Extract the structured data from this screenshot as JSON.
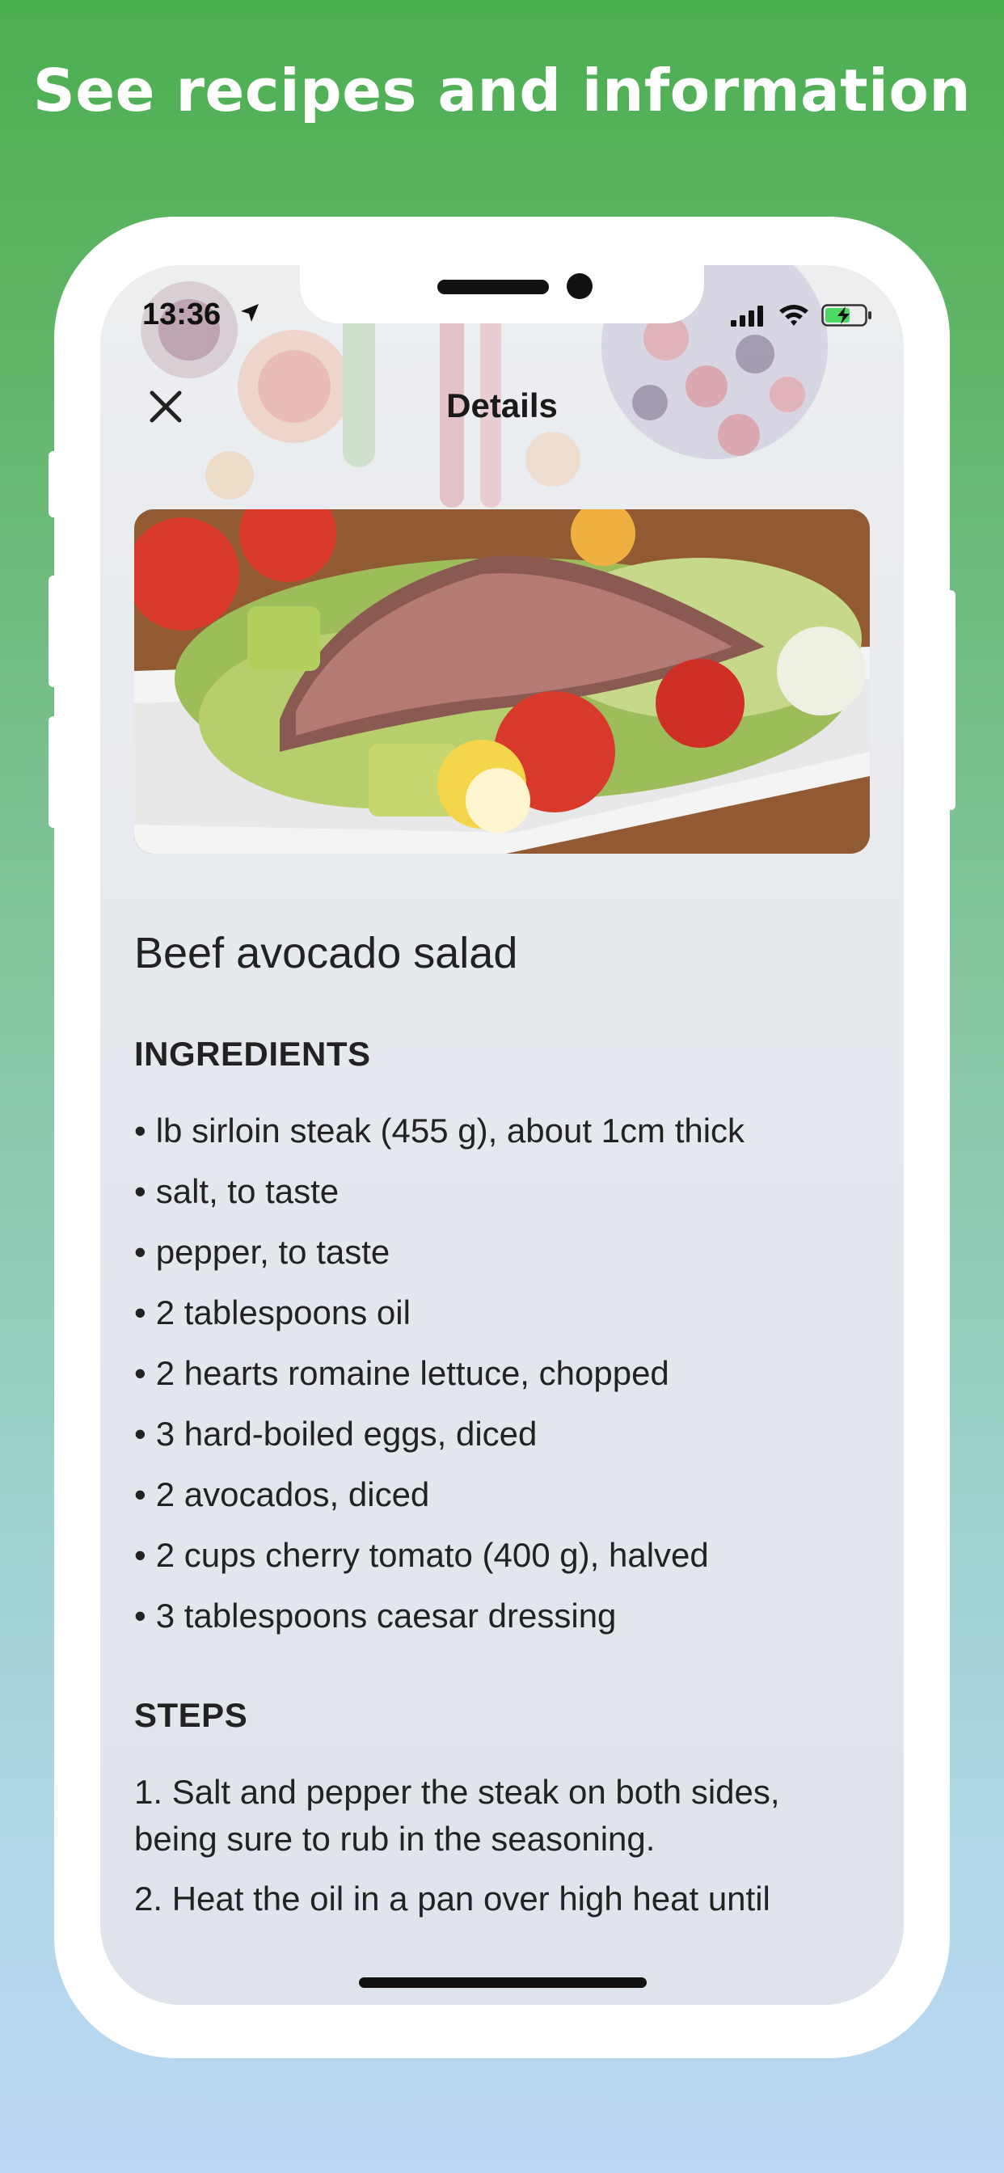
{
  "promo": {
    "headline": "See recipes and information"
  },
  "status_bar": {
    "time": "13:36"
  },
  "nav": {
    "title": "Details",
    "close_icon": "close-icon"
  },
  "recipe": {
    "title": "Beef avocado salad",
    "ingredients_heading": "INGREDIENTS",
    "ingredients": [
      "lb sirloin steak (455 g), about 1cm thick",
      "salt, to taste",
      "pepper, to taste",
      "2 tablespoons oil",
      "2 hearts romaine lettuce, chopped",
      "3 hard-boiled eggs, diced",
      "2 avocados, diced",
      "2 cups cherry tomato (400 g), halved",
      "3 tablespoons caesar dressing"
    ],
    "steps_heading": "STEPS",
    "steps": [
      "1. Salt and pepper the steak on both sides, being sure to rub in the seasoning.",
      "2. Heat the oil in a pan over high heat until"
    ]
  },
  "colors": {
    "gradient_top": "#4caf50",
    "gradient_bottom": "#bcd6f5",
    "phone_frame": "#ffffff",
    "text": "#222222"
  }
}
